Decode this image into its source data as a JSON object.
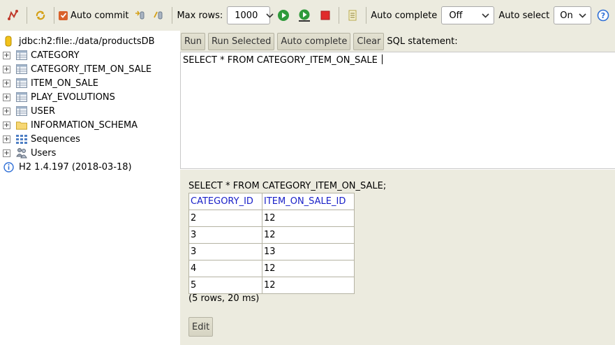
{
  "toolbar": {
    "auto_commit_label": "Auto commit",
    "max_rows_label": "Max rows:",
    "max_rows_value": "1000",
    "auto_complete_label": "Auto complete",
    "auto_complete_value": "Off",
    "auto_select_label": "Auto select",
    "auto_select_value": "On",
    "icons": [
      "disconnect-icon",
      "refresh-icon",
      "rollback-icon",
      "commit-icon",
      "run-icon",
      "run-selected-icon",
      "stop-icon",
      "history-icon",
      "help-icon"
    ],
    "accent_green": "#2e9a3a",
    "stop_red": "#e02b2b"
  },
  "tree": {
    "connection": "jdbc:h2:file:./data/productsDB",
    "items": [
      {
        "label": "CATEGORY",
        "icon": "table-icon"
      },
      {
        "label": "CATEGORY_ITEM_ON_SALE",
        "icon": "table-icon"
      },
      {
        "label": "ITEM_ON_SALE",
        "icon": "table-icon"
      },
      {
        "label": "PLAY_EVOLUTIONS",
        "icon": "table-icon"
      },
      {
        "label": "USER",
        "icon": "table-icon"
      },
      {
        "label": "INFORMATION_SCHEMA",
        "icon": "folder-icon"
      },
      {
        "label": "Sequences",
        "icon": "sequences-icon"
      },
      {
        "label": "Users",
        "icon": "users-icon"
      }
    ],
    "version": "H2 1.4.197 (2018-03-18)"
  },
  "query": {
    "run_label": "Run",
    "run_selected_label": "Run Selected",
    "auto_complete_label": "Auto complete",
    "clear_label": "Clear",
    "sql_statement_label": "SQL statement:",
    "sql_text": "SELECT * FROM CATEGORY_ITEM_ON_SALE "
  },
  "result": {
    "title": "SELECT * FROM CATEGORY_ITEM_ON_SALE;",
    "columns": [
      "CATEGORY_ID",
      "ITEM_ON_SALE_ID"
    ],
    "rows": [
      [
        "2",
        "12"
      ],
      [
        "3",
        "12"
      ],
      [
        "3",
        "13"
      ],
      [
        "4",
        "12"
      ],
      [
        "5",
        "12"
      ]
    ],
    "status": "(5 rows, 20 ms)",
    "edit_label": "Edit",
    "header_color": "#1a21c8"
  }
}
